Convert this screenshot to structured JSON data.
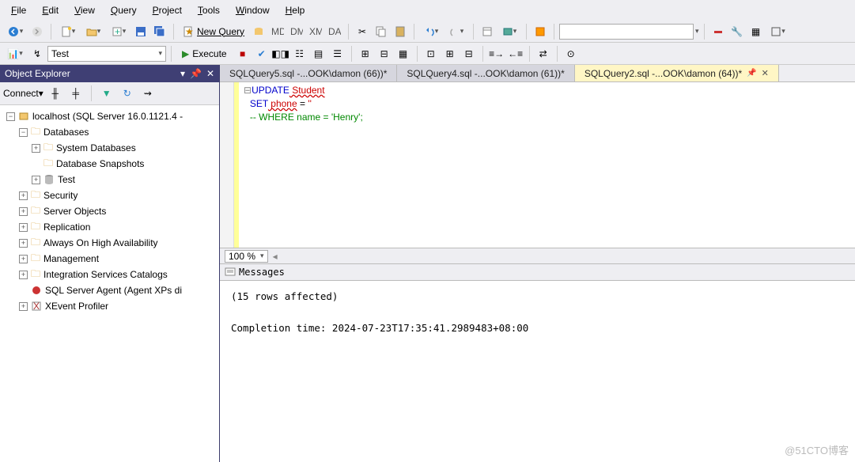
{
  "menu": {
    "file": "File",
    "edit": "Edit",
    "view": "View",
    "query": "Query",
    "project": "Project",
    "tools": "Tools",
    "window": "Window",
    "help": "Help"
  },
  "toolbar1": {
    "new_query": "New Query",
    "search_placeholder": ""
  },
  "toolbar2": {
    "db_select": "Test",
    "execute": "Execute"
  },
  "object_explorer": {
    "title": "Object Explorer",
    "connect": "Connect",
    "root": "localhost (SQL Server 16.0.1121.4 -",
    "databases": "Databases",
    "system_db": "System Databases",
    "db_snapshots": "Database Snapshots",
    "test": "Test",
    "security": "Security",
    "server_objects": "Server Objects",
    "replication": "Replication",
    "always_on": "Always On High Availability",
    "management": "Management",
    "isc": "Integration Services Catalogs",
    "agent": "SQL Server Agent (Agent XPs di",
    "xevent": "XEvent Profiler"
  },
  "tabs": {
    "t0": "SQLQuery5.sql -...OOK\\damon (66))*",
    "t1": "SQLQuery4.sql -...OOK\\damon (61))*",
    "t2": "SQLQuery2.sql -...OOK\\damon (64))*"
  },
  "code": {
    "l1a": "UPDATE",
    "l1b": " Student",
    "l2a": "SET",
    "l2b": " phone",
    "l2c": " = ",
    "l2d": "''",
    "l3": "-- WHERE name = 'Henry';"
  },
  "zoom": "100 %",
  "messages_label": "Messages",
  "messages_body": "(15 rows affected)\n\nCompletion time: 2024-07-23T17:35:41.2989483+08:00",
  "watermark": "@51CTO博客"
}
